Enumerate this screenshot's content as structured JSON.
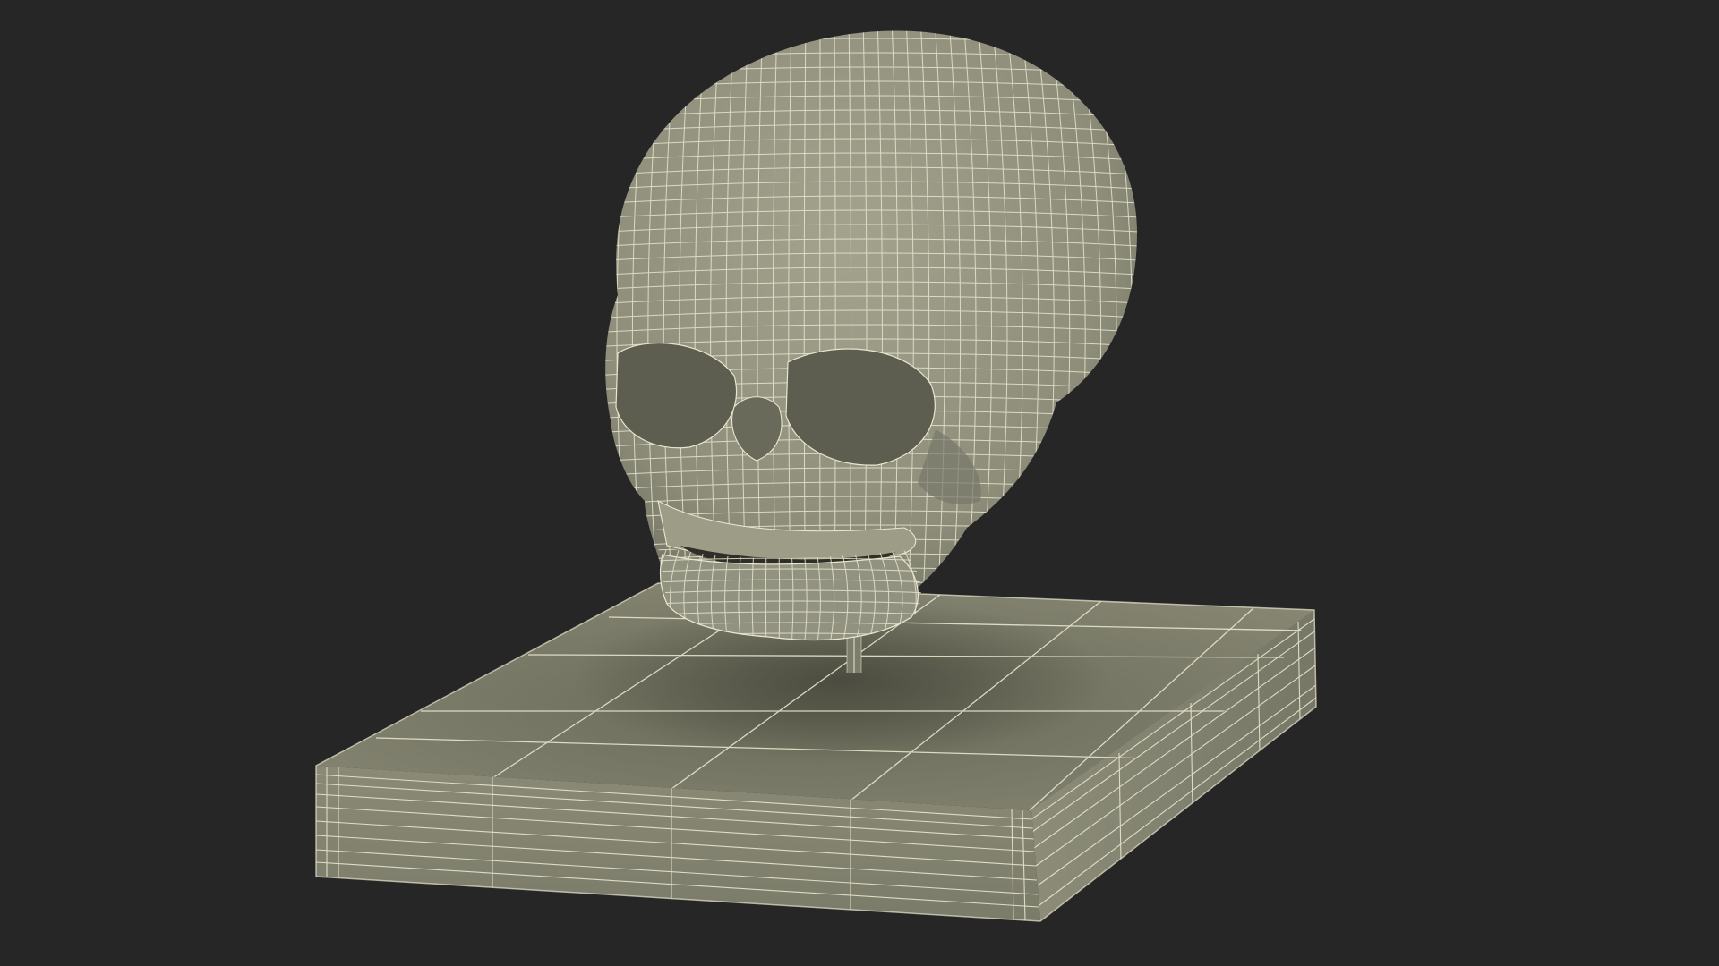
{
  "scene": {
    "subject": "wireframe-skull-on-base",
    "colors": {
      "background": "#262626",
      "mesh_fill": "#8b8b78",
      "mesh_fill_light": "#9e9e8a",
      "mesh_fill_dark": "#6f6f5f",
      "shadow": "#4a4a3e",
      "wire": "#e9e6cf",
      "socket": "#555548",
      "stem": "#7d7d6c"
    },
    "parts": [
      "skull",
      "jaw",
      "stem",
      "base"
    ]
  }
}
